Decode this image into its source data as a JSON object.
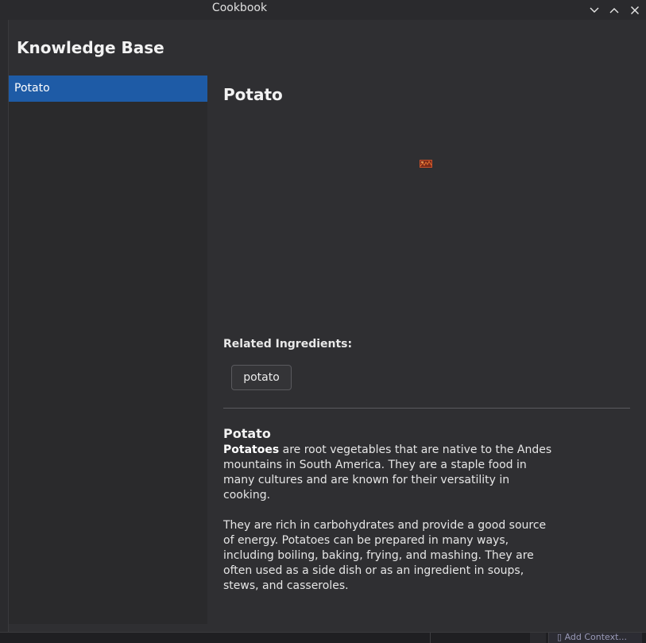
{
  "window": {
    "title": "Cookbook"
  },
  "sidebar": {
    "heading": "Knowledge Base",
    "items": [
      {
        "label": "Potato",
        "selected": true
      }
    ]
  },
  "main": {
    "title": "Potato",
    "image_icon": "broken-image-icon",
    "related_label": "Related Ingredients:",
    "related": [
      "potato"
    ],
    "article": {
      "heading": "Potato",
      "p1_bold": "Potatoes",
      "p1_rest": " are root vegetables that are native to the Andes mountains in South America. They are a staple food in many cultures and are known for their versatility in cooking.",
      "p2": "They are rich in carbohydrates and provide a good source of energy. Potatoes can be prepared in many ways, including boiling, baking, frying, and mashing. They are often used as a side dish or as an ingredient in soups, stews, and casseroles."
    }
  },
  "taskbar": {
    "context_label": "Add Context..."
  },
  "colors": {
    "selection": "#1e5ba6",
    "background": "#2f2f32",
    "sidebar": "#2a2a2c"
  }
}
